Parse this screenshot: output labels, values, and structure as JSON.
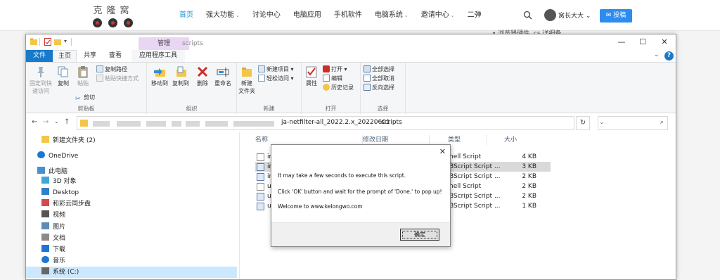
{
  "site": {
    "logo_text": "克隆窝",
    "nav": [
      {
        "label": "首页",
        "active": true,
        "caret": false
      },
      {
        "label": "强大功能",
        "active": false,
        "caret": true
      },
      {
        "label": "讨论中心",
        "active": false,
        "caret": false
      },
      {
        "label": "电脑应用",
        "active": false,
        "caret": false
      },
      {
        "label": "手机软件",
        "active": false,
        "caret": false
      },
      {
        "label": "电脑系统",
        "active": false,
        "caret": true
      },
      {
        "label": "邀请中心",
        "active": false,
        "caret": true
      },
      {
        "label": "二弹",
        "active": false,
        "caret": false
      }
    ],
    "caret_glyph": "⌄",
    "user_name": "窝长大大 ⌄",
    "post_button": "投稿",
    "post_icon": "✉",
    "bg_snippet": "• 浏览器硬件 .cs 详细备"
  },
  "explorer": {
    "context_tab": "管理",
    "title": "scripts",
    "window_controls": {
      "minimize": "—",
      "maximize": "☐",
      "close": "✕"
    },
    "tabs": {
      "file": "文件",
      "home": "主页",
      "share": "共享",
      "view": "查看",
      "app_tools": "应用程序工具"
    },
    "help_glyph": "?",
    "expand_glyph": "⌄",
    "ribbon": {
      "clipboard": {
        "label": "剪贴板",
        "pin": "固定到快\n速访问",
        "copy": "复制",
        "paste": "粘贴",
        "copy_path": "复制路径",
        "paste_shortcut": "粘贴快捷方式",
        "cut": "剪切"
      },
      "organize": {
        "label": "组织",
        "move_to": "移动到",
        "copy_to": "复制到",
        "delete": "删除",
        "rename": "重命名"
      },
      "new": {
        "label": "新建",
        "new_folder": "新建\n文件夹",
        "new_item": "新建项目 ▾",
        "easy_access": "轻松访问 ▾"
      },
      "open": {
        "label": "打开",
        "properties": "属性",
        "open": "打开 ▾",
        "edit": "编辑",
        "history": "历史记录"
      },
      "select": {
        "label": "选择",
        "select_all": "全部选择",
        "select_none": "全部取消",
        "invert": "反向选择"
      }
    },
    "address": {
      "back": "←",
      "forward": "→",
      "recent": "⌄",
      "up": "↑",
      "crumb_1": "ja-netfilter-all_2022.2.x_20220601",
      "separator": "›",
      "crumb_2": "scripts",
      "dropdown": "⌄",
      "refresh": "↻",
      "search_placeholder": "",
      "search_icon": "⌕"
    },
    "nav_pane": [
      {
        "label": "新建文件夹 (2)",
        "icon": "folder",
        "color": "#f3c64a"
      },
      {
        "label": "OneDrive",
        "icon": "cloud",
        "color": "#1d76d2"
      },
      {
        "label": "此电脑",
        "icon": "computer",
        "color": "#4a8fd1"
      },
      {
        "label": "3D 对象",
        "icon": "cube",
        "color": "#3fa7d6"
      },
      {
        "label": "Desktop",
        "icon": "desktop",
        "color": "#2f7fc9"
      },
      {
        "label": "和彩云同步盘",
        "icon": "app",
        "color": "#d14b4b"
      },
      {
        "label": "视频",
        "icon": "video",
        "color": "#555555"
      },
      {
        "label": "图片",
        "icon": "picture",
        "color": "#5b8db8"
      },
      {
        "label": "文档",
        "icon": "document",
        "color": "#8a8a8a"
      },
      {
        "label": "下载",
        "icon": "download",
        "color": "#1d76d2"
      },
      {
        "label": "音乐",
        "icon": "music",
        "color": "#1d76d2"
      },
      {
        "label": "系统 (C:)",
        "icon": "drive",
        "color": "#666666",
        "selected": true
      }
    ],
    "columns": {
      "name": "名称",
      "date": "修改日期",
      "type": "类型",
      "size": "大小"
    },
    "files": [
      {
        "name": "ins",
        "type": "hell Script",
        "size": "4 KB",
        "icon": "sh",
        "selected": false
      },
      {
        "name": "ins",
        "type": "BScript Script ...",
        "size": "3 KB",
        "icon": "vbs",
        "selected": true
      },
      {
        "name": "ins",
        "type": "BScript Script ...",
        "size": "2 KB",
        "icon": "vbs",
        "selected": false
      },
      {
        "name": "un",
        "type": "hell Script",
        "size": "2 KB",
        "icon": "sh",
        "selected": false
      },
      {
        "name": "un",
        "type": "BScript Script ...",
        "size": "2 KB",
        "icon": "vbs",
        "selected": false
      },
      {
        "name": "un",
        "type": "BScript Script ...",
        "size": "1 KB",
        "icon": "vbs",
        "selected": false
      }
    ]
  },
  "dialog": {
    "close": "✕",
    "line_1": "It may take a few seconds to execute this script.",
    "line_2": "Click 'OK' button and wait for the prompt of 'Done.' to pop up!",
    "line_3": "Welcome to www.kelongwo.com",
    "ok": "确定"
  }
}
